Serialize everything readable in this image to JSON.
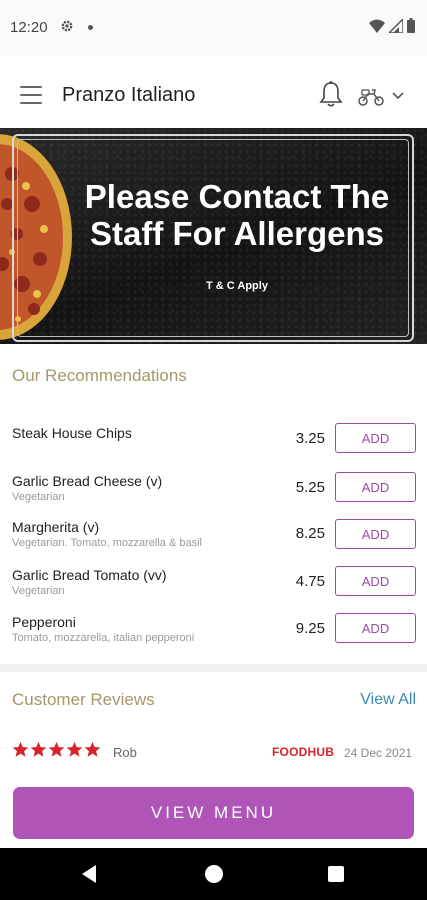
{
  "status_bar": {
    "time": "12:20",
    "icons": [
      "gear-icon",
      "dot-icon",
      "wifi-icon",
      "signal-icon",
      "battery-icon"
    ]
  },
  "header": {
    "title": "Pranzo Italiano",
    "icons": [
      "menu-icon",
      "bell-icon",
      "scooter-icon",
      "chevron-down-icon"
    ]
  },
  "banner": {
    "title_line1": "Please Contact The",
    "title_line2": "Staff For Allergens",
    "terms": "T & C Apply"
  },
  "recommendations": {
    "title": "Our Recommendations",
    "add_label": "ADD",
    "items": [
      {
        "name": "Steak House Chips",
        "description": "",
        "price": "3.25"
      },
      {
        "name": "Garlic Bread Cheese (v)",
        "description": "Vegetarian",
        "price": "5.25"
      },
      {
        "name": "Margherita (v)",
        "description": "Vegetarian. Tomato, mozzarella & basil",
        "price": "8.25"
      },
      {
        "name": "Garlic Bread Tomato (vv)",
        "description": "Vegetarian",
        "price": "4.75"
      },
      {
        "name": "Pepperoni",
        "description": "Tomato, mozzarella, italian pepperoni",
        "price": "9.25"
      }
    ]
  },
  "reviews": {
    "title": "Customer Reviews",
    "view_all": "View All",
    "review": {
      "rating": 5,
      "reviewer": "Rob",
      "source": "FOODHUB",
      "date": "24 Dec 2021"
    }
  },
  "view_menu_label": "VIEW MENU",
  "colors": {
    "accent": "#b055b8",
    "add_border": "#9c4aa6",
    "section_title": "#a8966a",
    "link": "#3a8ab0",
    "star": "#d8232a"
  },
  "nav_bar": {
    "icons": [
      "back-icon",
      "home-icon",
      "recents-icon"
    ]
  }
}
